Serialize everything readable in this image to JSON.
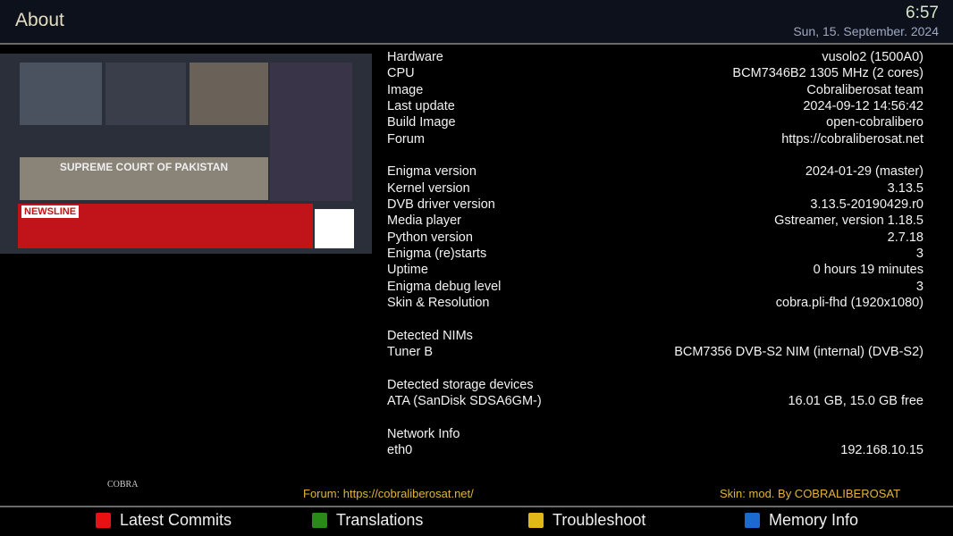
{
  "header": {
    "title": "About",
    "time": "6:57",
    "date": "Sun, 15. September. 2024"
  },
  "preview": {
    "banner": "SUPREME COURT OF PAKISTAN",
    "channel": "NEWSLINE"
  },
  "info": [
    {
      "label": "Hardware",
      "value": "vusolo2 (1500A0)"
    },
    {
      "label": "CPU",
      "value": "BCM7346B2 1305 MHz (2 cores)"
    },
    {
      "label": "Image",
      "value": "Cobraliberosat team"
    },
    {
      "label": "Last update",
      "value": "2024-09-12 14:56:42"
    },
    {
      "label": "Build Image",
      "value": "open-cobralibero"
    },
    {
      "label": "Forum",
      "value": "https://cobraliberosat.net"
    },
    null,
    {
      "label": "Enigma version",
      "value": "2024-01-29 (master)"
    },
    {
      "label": "Kernel version",
      "value": "3.13.5"
    },
    {
      "label": "DVB driver version",
      "value": "3.13.5-20190429.r0"
    },
    {
      "label": "Media player",
      "value": "Gstreamer, version 1.18.5"
    },
    {
      "label": "Python version",
      "value": "2.7.18"
    },
    {
      "label": "Enigma (re)starts",
      "value": "3"
    },
    {
      "label": "Uptime",
      "value": "0 hours 19 minutes"
    },
    {
      "label": "Enigma debug level",
      "value": "3"
    },
    {
      "label": "Skin & Resolution",
      "value": "cobra.pli-fhd (1920x1080)"
    },
    null,
    {
      "label": "Detected NIMs",
      "value": ""
    },
    {
      "label": "Tuner B",
      "value": "BCM7356 DVB-S2 NIM (internal) (DVB-S2)"
    },
    null,
    {
      "label": "Detected storage devices",
      "value": ""
    },
    {
      "label": "ATA (SanDisk SDSA6GM-)",
      "value": "16.01 GB, 15.0 GB free"
    },
    null,
    {
      "label": "Network Info",
      "value": "",
      "_": ""
    },
    {
      "label": "eth0",
      "value": "192.168.10.15"
    }
  ],
  "footer": {
    "forum": "Forum: https://cobraliberosat.net/",
    "skin": "Skin: mod. By COBRALIBEROSAT",
    "logo_text": "COBRA"
  },
  "buttons": [
    {
      "label": "Latest Commits",
      "color": "#e81010"
    },
    {
      "label": "Translations",
      "color": "#2a8a18"
    },
    {
      "label": "Troubleshoot",
      "color": "#e2b818"
    },
    {
      "label": "Memory Info",
      "color": "#1a6ad0"
    }
  ]
}
